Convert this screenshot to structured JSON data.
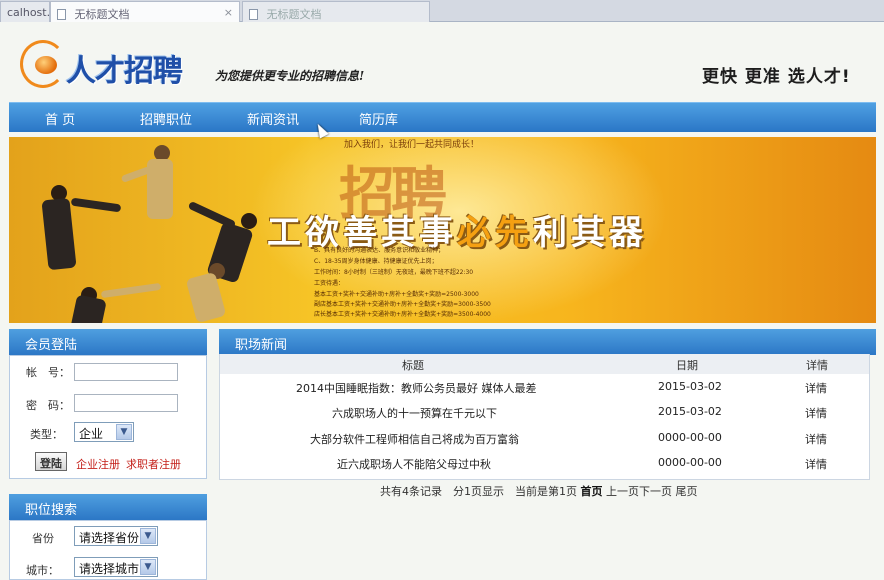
{
  "browser": {
    "tabs": [
      {
        "label": "calhost..."
      },
      {
        "label": "无标题文档",
        "close": "×"
      },
      {
        "label": "无标题文档"
      }
    ]
  },
  "header": {
    "logo_text": "人才招聘",
    "slogan": "为您提供更专业的招聘信息!",
    "tagline": "更快 更准 选人才!"
  },
  "nav": {
    "items": [
      "首 页",
      "招聘职位",
      "新闻资讯",
      "简历库"
    ]
  },
  "banner": {
    "big_text": "招聘",
    "top_line": "加入我们，让我们一起共同成长！",
    "headline": "工欲善其事必先利其器",
    "requirements": [
      "B、具有良好的沟通表达、服务意识和敬业精神；",
      "C、18-35周岁身体健康、持健康证优先上岗；",
      "工作时间：8小时制（三班制）无夜班，最晚下班不超22:30",
      "工资待遇：",
      "基本工资+奖补+交通补助+房补+全勤奖+奖励=2500-3000",
      "副店基本工资+奖补+交通补助+房补+全勤奖+奖励=3000-3500",
      "店长基本工资+奖补+交通补助+房补+全勤奖+奖励=3500-4000"
    ]
  },
  "login": {
    "title": "会员登陆",
    "account_label": "帐　号：",
    "password_label": "密　码：",
    "type_label": "类型：",
    "type_value": "企业",
    "submit": "登陆",
    "company_register": "企业注册",
    "seeker_register": "求职者注册"
  },
  "job_search": {
    "title": "职位搜索",
    "province_label": "省份",
    "province_value": "请选择省份",
    "city_label": "城市：",
    "city_value": "请选择城市"
  },
  "news": {
    "title": "职场新闻",
    "columns": [
      "标题",
      "日期",
      "详情"
    ],
    "rows": [
      {
        "title": "2014中国睡眠指数：教师公务员最好 媒体人最差",
        "date": "2015-03-02",
        "detail": "详情"
      },
      {
        "title": "六成职场人的十一预算在千元以下",
        "date": "2015-03-02",
        "detail": "详情"
      },
      {
        "title": "大部分软件工程师相信自己将成为百万富翁",
        "date": "0000-00-00",
        "detail": "详情"
      },
      {
        "title": "近六成职场人不能陪父母过中秋",
        "date": "0000-00-00",
        "detail": "详情"
      }
    ],
    "pager": {
      "summary": "共有4条记录　分1页显示　当前是第1页",
      "first": "首页",
      "prev": "上一页",
      "next": "下一页",
      "last": "尾页"
    }
  },
  "colors": {
    "nav_blue": "#2a76c6",
    "banner_orange": "#f6c426",
    "link_red": "#c4201a"
  }
}
